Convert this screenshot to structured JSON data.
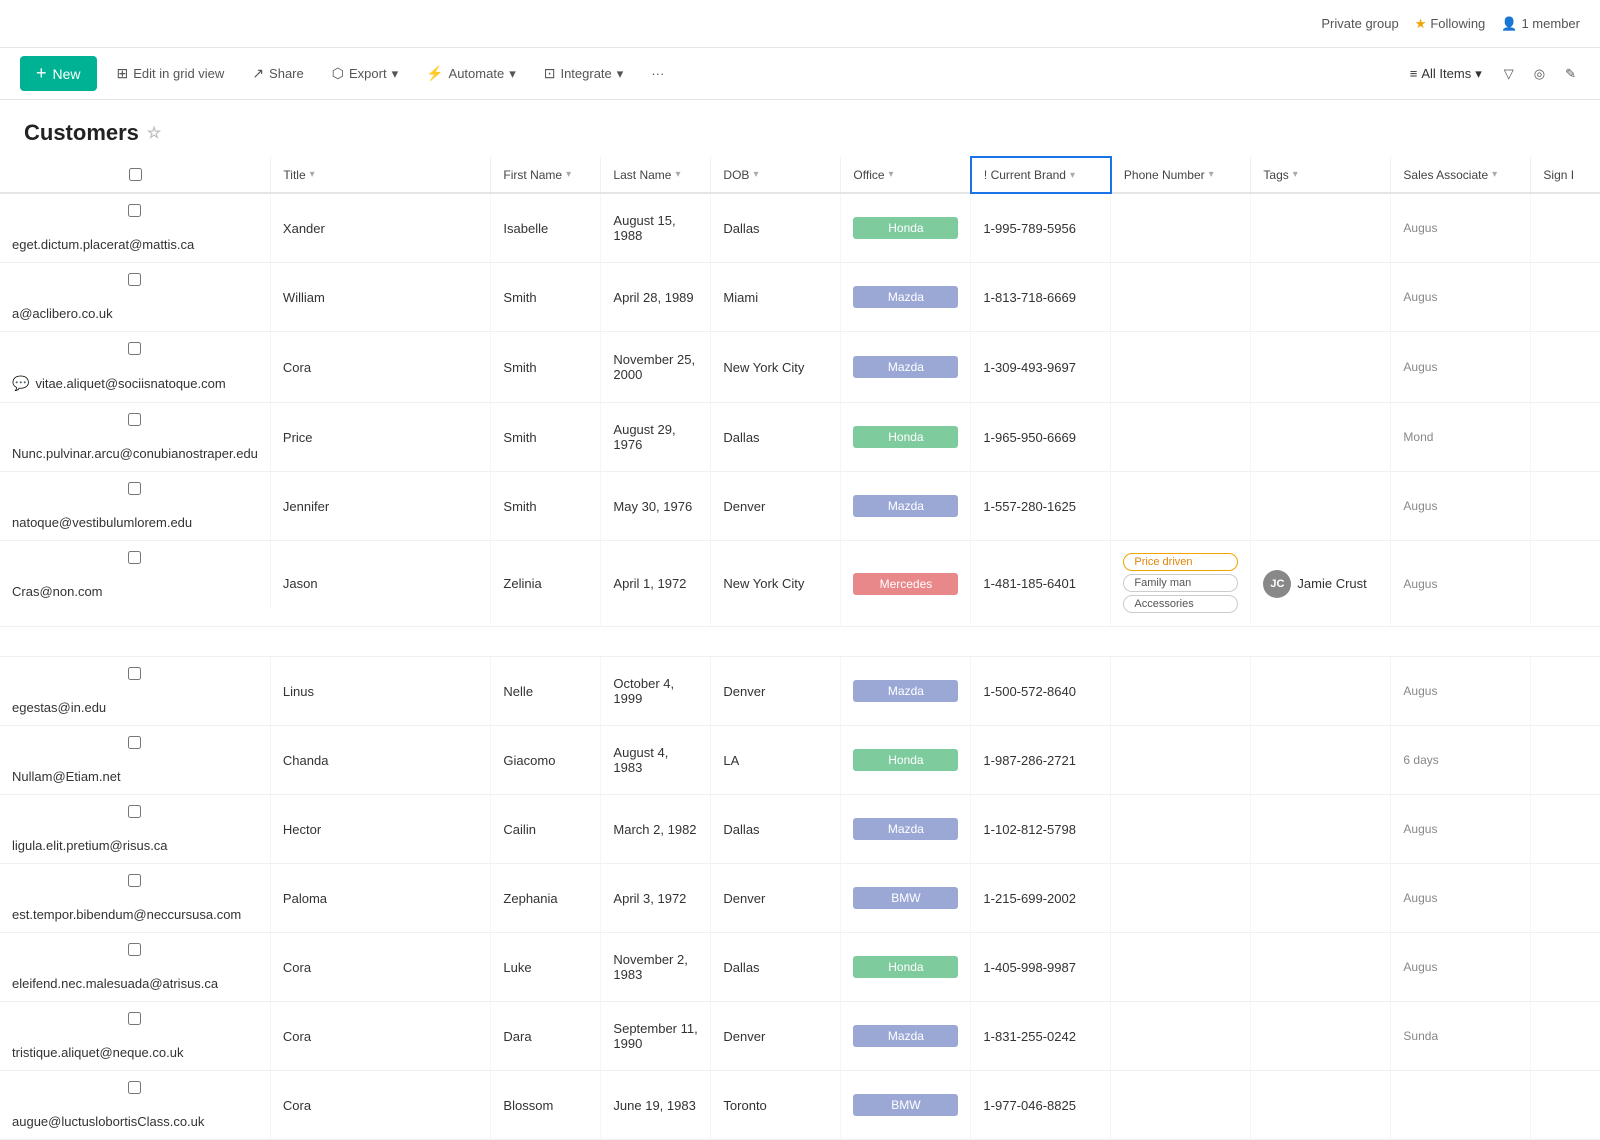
{
  "topbar": {
    "private_group": "Private group",
    "following": "Following",
    "member_count": "1 member"
  },
  "toolbar": {
    "new_label": "+ New",
    "edit_grid": "Edit in grid view",
    "share": "Share",
    "export": "Export",
    "automate": "Automate",
    "integrate": "Integrate",
    "more": "···",
    "all_items": "All Items"
  },
  "page": {
    "title": "Customers"
  },
  "columns": [
    {
      "id": "title",
      "label": "Title"
    },
    {
      "id": "firstname",
      "label": "First Name"
    },
    {
      "id": "lastname",
      "label": "Last Name"
    },
    {
      "id": "dob",
      "label": "DOB"
    },
    {
      "id": "office",
      "label": "Office"
    },
    {
      "id": "current_brand",
      "label": "Current Brand"
    },
    {
      "id": "phone",
      "label": "Phone Number"
    },
    {
      "id": "tags",
      "label": "Tags"
    },
    {
      "id": "sales",
      "label": "Sales Associate"
    },
    {
      "id": "sign",
      "label": "Sign I"
    }
  ],
  "rows": [
    {
      "title": "eget.dictum.placerat@mattis.ca",
      "firstname": "Xander",
      "lastname": "Isabelle",
      "dob": "August 15, 1988",
      "office": "Dallas",
      "brand": "Honda",
      "brand_class": "brand-honda",
      "phone": "1-995-789-5956",
      "tags": [],
      "sales": "",
      "sign": "Augus",
      "msg": false
    },
    {
      "title": "a@aclibero.co.uk",
      "firstname": "William",
      "lastname": "Smith",
      "dob": "April 28, 1989",
      "office": "Miami",
      "brand": "Mazda",
      "brand_class": "brand-mazda",
      "phone": "1-813-718-6669",
      "tags": [],
      "sales": "",
      "sign": "Augus",
      "msg": false
    },
    {
      "title": "vitae.aliquet@sociisnatoque.com",
      "firstname": "Cora",
      "lastname": "Smith",
      "dob": "November 25, 2000",
      "office": "New York City",
      "brand": "Mazda",
      "brand_class": "brand-mazda",
      "phone": "1-309-493-9697",
      "tags": [],
      "sales": "",
      "sign": "Augus",
      "msg": true
    },
    {
      "title": "Nunc.pulvinar.arcu@conubianostraper.edu",
      "firstname": "Price",
      "lastname": "Smith",
      "dob": "August 29, 1976",
      "office": "Dallas",
      "brand": "Honda",
      "brand_class": "brand-honda",
      "phone": "1-965-950-6669",
      "tags": [],
      "sales": "",
      "sign": "Mond",
      "msg": false
    },
    {
      "title": "natoque@vestibulumlorem.edu",
      "firstname": "Jennifer",
      "lastname": "Smith",
      "dob": "May 30, 1976",
      "office": "Denver",
      "brand": "Mazda",
      "brand_class": "brand-mazda",
      "phone": "1-557-280-1625",
      "tags": [],
      "sales": "",
      "sign": "Augus",
      "msg": false
    },
    {
      "title": "Cras@non.com",
      "firstname": "Jason",
      "lastname": "Zelinia",
      "dob": "April 1, 1972",
      "office": "New York City",
      "brand": "Mercedes",
      "brand_class": "brand-mercedes",
      "phone": "1-481-185-6401",
      "tags": [
        "Price driven",
        "Family man",
        "Accessories"
      ],
      "sales": "Jamie Crust",
      "sales_initials": "JC",
      "sign": "Augus",
      "msg": false
    },
    {
      "title": "",
      "firstname": "",
      "lastname": "",
      "dob": "",
      "office": "",
      "brand": "",
      "brand_class": "",
      "phone": "",
      "tags": [],
      "sales": "",
      "sign": "",
      "msg": false,
      "empty": true
    },
    {
      "title": "egestas@in.edu",
      "firstname": "Linus",
      "lastname": "Nelle",
      "dob": "October 4, 1999",
      "office": "Denver",
      "brand": "Mazda",
      "brand_class": "brand-mazda",
      "phone": "1-500-572-8640",
      "tags": [],
      "sales": "",
      "sign": "Augus",
      "msg": false
    },
    {
      "title": "Nullam@Etiam.net",
      "firstname": "Chanda",
      "lastname": "Giacomo",
      "dob": "August 4, 1983",
      "office": "LA",
      "brand": "Honda",
      "brand_class": "brand-honda",
      "phone": "1-987-286-2721",
      "tags": [],
      "sales": "",
      "sign": "6 days",
      "msg": false
    },
    {
      "title": "ligula.elit.pretium@risus.ca",
      "firstname": "Hector",
      "lastname": "Cailin",
      "dob": "March 2, 1982",
      "office": "Dallas",
      "brand": "Mazda",
      "brand_class": "brand-mazda",
      "phone": "1-102-812-5798",
      "tags": [],
      "sales": "",
      "sign": "Augus",
      "msg": false
    },
    {
      "title": "est.tempor.bibendum@neccursusa.com",
      "firstname": "Paloma",
      "lastname": "Zephania",
      "dob": "April 3, 1972",
      "office": "Denver",
      "brand": "BMW",
      "brand_class": "brand-bmw",
      "phone": "1-215-699-2002",
      "tags": [],
      "sales": "",
      "sign": "Augus",
      "msg": false
    },
    {
      "title": "eleifend.nec.malesuada@atrisus.ca",
      "firstname": "Cora",
      "lastname": "Luke",
      "dob": "November 2, 1983",
      "office": "Dallas",
      "brand": "Honda",
      "brand_class": "brand-honda",
      "phone": "1-405-998-9987",
      "tags": [],
      "sales": "",
      "sign": "Augus",
      "msg": false
    },
    {
      "title": "tristique.aliquet@neque.co.uk",
      "firstname": "Cora",
      "lastname": "Dara",
      "dob": "September 11, 1990",
      "office": "Denver",
      "brand": "Mazda",
      "brand_class": "brand-mazda",
      "phone": "1-831-255-0242",
      "tags": [],
      "sales": "",
      "sign": "Sunda",
      "msg": false
    },
    {
      "title": "augue@luctuslobortisClass.co.uk",
      "firstname": "Cora",
      "lastname": "Blossom",
      "dob": "June 19, 1983",
      "office": "Toronto",
      "brand": "BMW",
      "brand_class": "brand-bmw",
      "phone": "1-977-046-8825",
      "tags": [],
      "sales": "",
      "sign": "",
      "msg": false,
      "partial": true
    }
  ]
}
